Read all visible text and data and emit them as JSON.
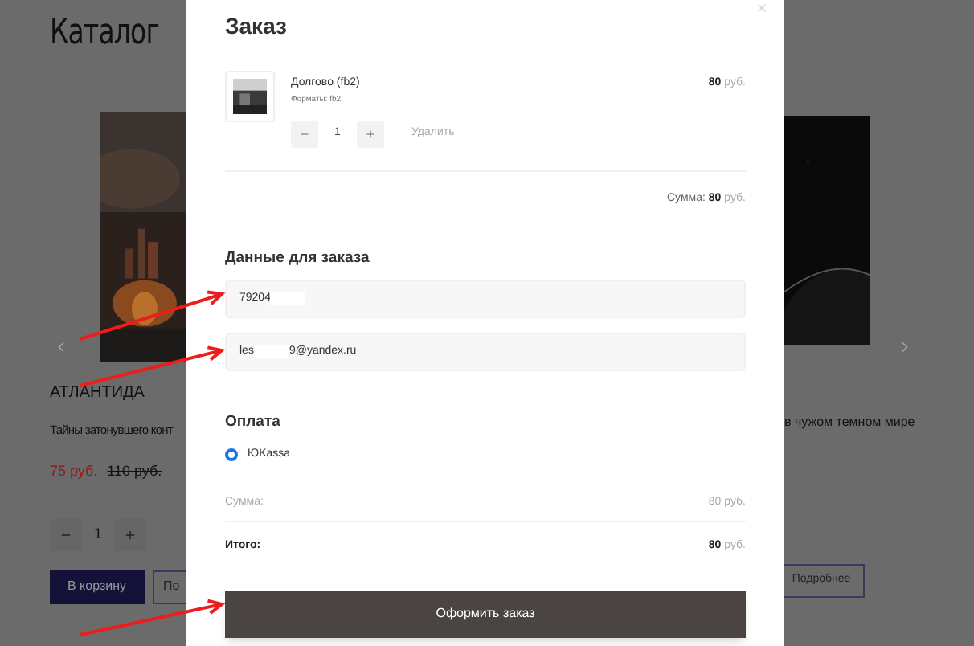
{
  "catalog": {
    "title": "Каталог",
    "left_card": {
      "name": "АТЛАНТИДА",
      "description": "Тайны затонувшего конт",
      "price": "75 руб.",
      "old_price": "110 руб.",
      "quantity": "1",
      "buttons": [
        {
          "label": "В корзину",
          "kind": "primary"
        },
        {
          "label": "По",
          "kind": "outline"
        }
      ]
    },
    "right_card": {
      "description": "в чужом темном мире",
      "button": "Подробнее"
    }
  },
  "order": {
    "title": "Заказ",
    "item": {
      "name": "Долгово (fb2)",
      "formats": "Форматы: fb2;",
      "quantity": "1",
      "remove": "Удалить",
      "price": "80",
      "currency": "руб."
    },
    "subtotal": {
      "label": "Сумма:",
      "value": "80",
      "currency": "руб."
    },
    "details_title": "Данные для заказа",
    "fields": [
      {
        "value_start": "79204"
      },
      {
        "value_start": "les",
        "value_end": "9@yandex.ru"
      }
    ],
    "payment_title": "Оплата",
    "payment_options": [
      {
        "label": "ЮKassa",
        "selected": true
      }
    ],
    "summary": [
      {
        "label": "Сумма:",
        "value": "80",
        "currency": "руб.",
        "kind": "muted"
      },
      {
        "label": "Итого:",
        "value": "80",
        "currency": "руб.",
        "kind": "total"
      }
    ],
    "submit": "Оформить заказ"
  }
}
